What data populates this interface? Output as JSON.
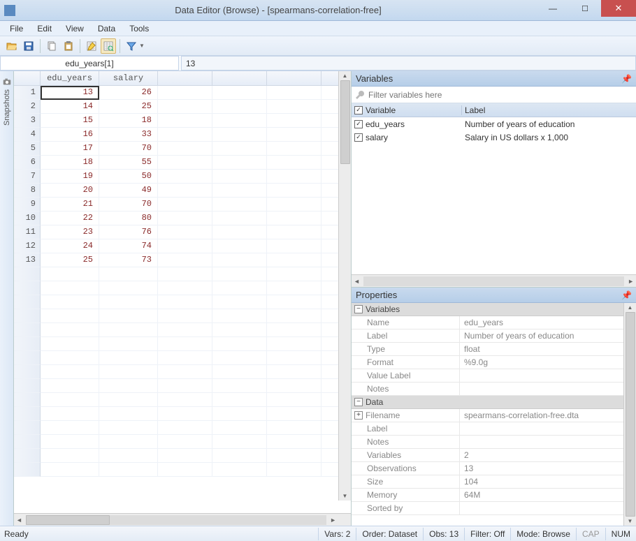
{
  "title": "Data Editor (Browse) - [spearmans-correlation-free]",
  "menu": [
    "File",
    "Edit",
    "View",
    "Data",
    "Tools"
  ],
  "namebar": {
    "name": "edu_years[1]",
    "value": "13"
  },
  "snapshots_label": "Snapshots",
  "columns": [
    "edu_years",
    "salary"
  ],
  "rows": [
    {
      "n": 1,
      "edu_years": 13,
      "salary": 26
    },
    {
      "n": 2,
      "edu_years": 14,
      "salary": 25
    },
    {
      "n": 3,
      "edu_years": 15,
      "salary": 18
    },
    {
      "n": 4,
      "edu_years": 16,
      "salary": 33
    },
    {
      "n": 5,
      "edu_years": 17,
      "salary": 70
    },
    {
      "n": 6,
      "edu_years": 18,
      "salary": 55
    },
    {
      "n": 7,
      "edu_years": 19,
      "salary": 50
    },
    {
      "n": 8,
      "edu_years": 20,
      "salary": 49
    },
    {
      "n": 9,
      "edu_years": 21,
      "salary": 70
    },
    {
      "n": 10,
      "edu_years": 22,
      "salary": 80
    },
    {
      "n": 11,
      "edu_years": 23,
      "salary": 76
    },
    {
      "n": 12,
      "edu_years": 24,
      "salary": 74
    },
    {
      "n": 13,
      "edu_years": 25,
      "salary": 73
    }
  ],
  "variables_panel": {
    "title": "Variables",
    "filter_placeholder": "Filter variables here",
    "header_var": "Variable",
    "header_label": "Label",
    "items": [
      {
        "name": "edu_years",
        "label": "Number of years of education"
      },
      {
        "name": "salary",
        "label": "Salary in US dollars x 1,000"
      }
    ]
  },
  "properties_panel": {
    "title": "Properties",
    "section_variables": "Variables",
    "var_props": {
      "Name": "edu_years",
      "Label": "Number of years of education",
      "Type": "float",
      "Format": "%9.0g",
      "Value Label": "",
      "Notes": ""
    },
    "section_data": "Data",
    "data_props": {
      "Filename": "spearmans-correlation-free.dta",
      "Label": "",
      "Notes": "",
      "Variables": "2",
      "Observations": "13",
      "Size": "104",
      "Memory": "64M",
      "Sorted by": ""
    }
  },
  "status": {
    "ready": "Ready",
    "vars": "Vars: 2",
    "order": "Order: Dataset",
    "obs": "Obs: 13",
    "filter": "Filter: Off",
    "mode": "Mode: Browse",
    "cap": "CAP",
    "num": "NUM"
  },
  "chart_data": {
    "type": "table",
    "title": "spearmans-correlation-free",
    "columns": [
      "edu_years",
      "salary"
    ],
    "column_labels": [
      "Number of years of education",
      "Salary in US dollars x 1,000"
    ],
    "data": [
      [
        13,
        26
      ],
      [
        14,
        25
      ],
      [
        15,
        18
      ],
      [
        16,
        33
      ],
      [
        17,
        70
      ],
      [
        18,
        55
      ],
      [
        19,
        50
      ],
      [
        20,
        49
      ],
      [
        21,
        70
      ],
      [
        22,
        80
      ],
      [
        23,
        76
      ],
      [
        24,
        74
      ],
      [
        25,
        73
      ]
    ]
  }
}
